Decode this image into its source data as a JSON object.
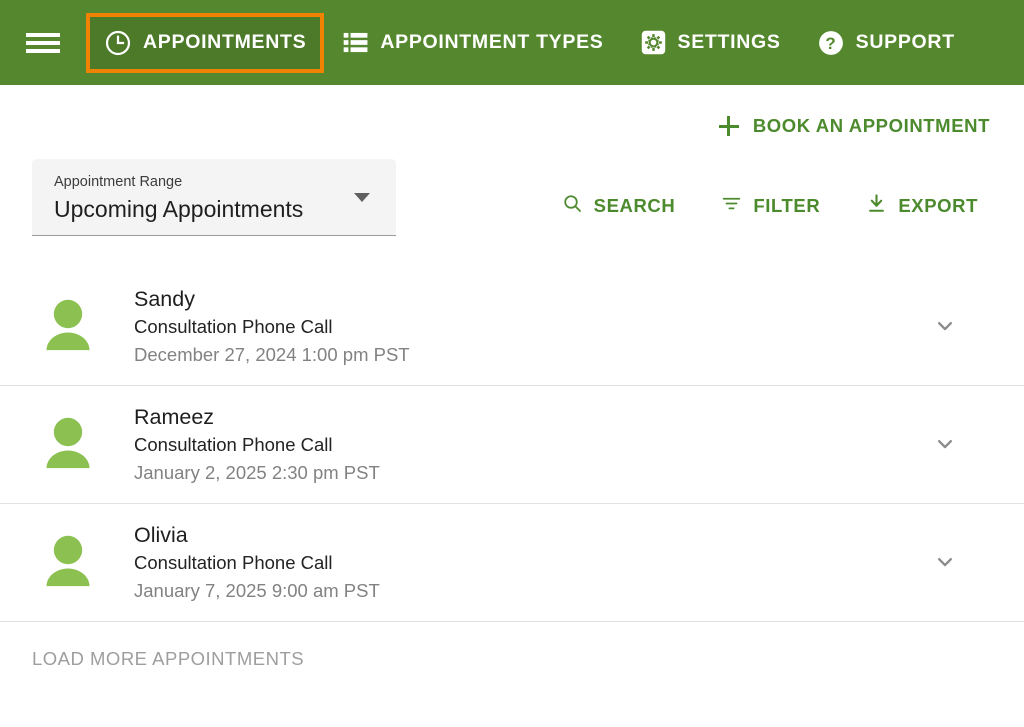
{
  "header": {
    "menu_icon": "hamburger-menu-icon",
    "nav": [
      {
        "label": "APPOINTMENTS",
        "icon": "clock-icon",
        "active": true
      },
      {
        "label": "APPOINTMENT TYPES",
        "icon": "list-view-icon",
        "active": false
      },
      {
        "label": "SETTINGS",
        "icon": "gear-icon",
        "active": false
      },
      {
        "label": "SUPPORT",
        "icon": "question-mark-circle-icon",
        "active": false
      }
    ],
    "active_highlight_color": "#ef8200",
    "background_color": "#55882e"
  },
  "toolbar": {
    "book_label": "BOOK AN APPOINTMENT",
    "book_icon": "plus-icon",
    "search_label": "SEARCH",
    "search_icon": "search-icon",
    "filter_label": "FILTER",
    "filter_icon": "filter-icon",
    "export_label": "EXPORT",
    "export_icon": "download-icon",
    "accent_color": "#4c8a2e"
  },
  "range_select": {
    "label": "Appointment Range",
    "value": "Upcoming Appointments",
    "arrow_icon": "dropdown-arrow-icon"
  },
  "appointments": [
    {
      "name": "Sandy",
      "type": "Consultation Phone Call",
      "datetime": "December 27, 2024 1:00 pm PST",
      "avatar_icon": "person-avatar-icon",
      "expand_icon": "chevron-down-icon"
    },
    {
      "name": "Rameez",
      "type": "Consultation Phone Call",
      "datetime": "January 2, 2025 2:30 pm PST",
      "avatar_icon": "person-avatar-icon",
      "expand_icon": "chevron-down-icon"
    },
    {
      "name": "Olivia",
      "type": "Consultation Phone Call",
      "datetime": "January 7, 2025 9:00 am PST",
      "avatar_icon": "person-avatar-icon",
      "expand_icon": "chevron-down-icon"
    }
  ],
  "footer": {
    "load_more_label": "LOAD MORE APPOINTMENTS"
  }
}
